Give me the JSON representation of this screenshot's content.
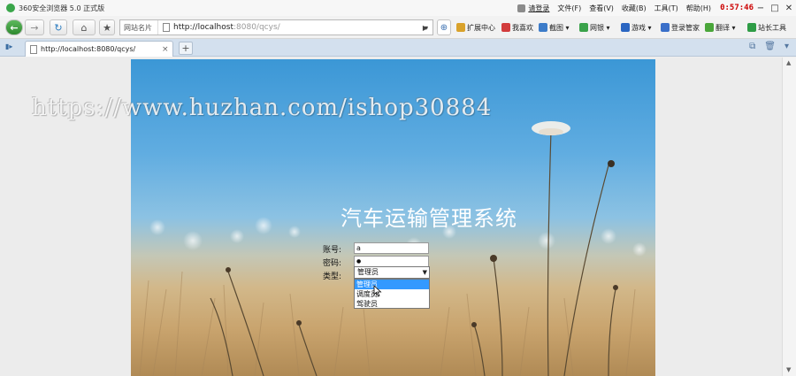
{
  "window": {
    "title": "360安全浏览器 5.0 正式版",
    "login_label": "请登录",
    "menus": [
      "文件(F)",
      "查看(V)",
      "收藏(B)",
      "工具(T)",
      "帮助(H)"
    ],
    "clock": "0:57:46",
    "controls": {
      "minimize": "−",
      "maximize": "□",
      "close": "✕"
    }
  },
  "toolbar": {
    "back": "←",
    "forward": "→",
    "refresh": "↻",
    "home": "⌂",
    "favorite": "★",
    "site_names": "网站名片",
    "address_host": "http://localhost",
    "address_path": ":8080/qcys/",
    "go": "▶",
    "items": [
      {
        "label": "扩展中心",
        "color": "#d9a22b"
      },
      {
        "label": "我喜欢",
        "color": "#d23c3c"
      },
      {
        "label": "截图",
        "color": "#3d7cc9"
      },
      {
        "label": "网银",
        "color": "#3aa24a"
      },
      {
        "label": "游戏",
        "color": "#2b66c2"
      },
      {
        "label": "登录管家",
        "color": "#3a6fc9"
      },
      {
        "label": "翻译",
        "color": "#4aa63a"
      },
      {
        "label": "站长工具",
        "color": "#2e9c46"
      }
    ]
  },
  "tabs": {
    "active": {
      "label": "http://localhost:8080/qcys/",
      "close": "×"
    },
    "new_tab": "+"
  },
  "page": {
    "watermark": "https://www.huzhan.com/ishop30884",
    "system_title": "汽车运输管理系统",
    "form": {
      "account_label": "账号:",
      "account_value": "a",
      "password_label": "密码:",
      "password_value": "●",
      "type_label": "类型:",
      "type_selected": "管理员",
      "type_options": [
        "管理员",
        "调度员",
        "驾驶员"
      ]
    }
  }
}
